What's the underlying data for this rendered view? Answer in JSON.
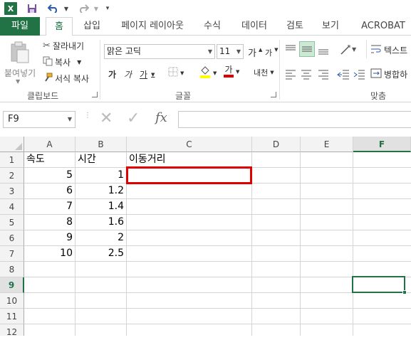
{
  "quick_access": {
    "excel_icon": "excel-icon",
    "save_icon": "save-icon",
    "undo_icon": "undo-icon",
    "redo_icon": "redo-icon",
    "customize_icon": "customize-icon"
  },
  "tabs": [
    {
      "label": "파일"
    },
    {
      "label": "홈"
    },
    {
      "label": "삽입"
    },
    {
      "label": "페이지 레이아웃"
    },
    {
      "label": "수식"
    },
    {
      "label": "데이터"
    },
    {
      "label": "검토"
    },
    {
      "label": "보기"
    },
    {
      "label": "ACROBAT"
    }
  ],
  "ribbon": {
    "clipboard": {
      "paste": "붙여넣기",
      "cut": "잘라내기",
      "copy": "복사",
      "format_painter": "서식 복사",
      "group": "클립보드"
    },
    "font": {
      "font_name": "맑은 고딕",
      "font_size": "11",
      "grow": "가",
      "shrink": "가",
      "bold": "가",
      "italic": "가",
      "underline": "가",
      "font_color": "가",
      "phonetic": "내천",
      "group": "글꼴"
    },
    "alignment": {
      "wrap": "텍스트",
      "merge": "병합하",
      "group": "맞춤"
    }
  },
  "formula_bar": {
    "name_box": "F9",
    "cancel": "✕",
    "enter": "✓",
    "fx": "fx",
    "value": ""
  },
  "columns": [
    "A",
    "B",
    "C",
    "D",
    "E",
    "F"
  ],
  "rows": [
    "1",
    "2",
    "3",
    "4",
    "5",
    "6",
    "7",
    "8",
    "9",
    "10",
    "11",
    "12"
  ],
  "cells": {
    "A1": "속도",
    "B1": "시간",
    "C1": "이동거리",
    "A2": "5",
    "B2": "1",
    "A3": "6",
    "B3": "1.2",
    "A4": "7",
    "B4": "1.4",
    "A5": "8",
    "B5": "1.6",
    "A6": "9",
    "B6": "2",
    "A7": "10",
    "B7": "2.5"
  },
  "colors": {
    "accent": "#217346",
    "highlight_box": "#e00000"
  },
  "selected_cell": "F9"
}
